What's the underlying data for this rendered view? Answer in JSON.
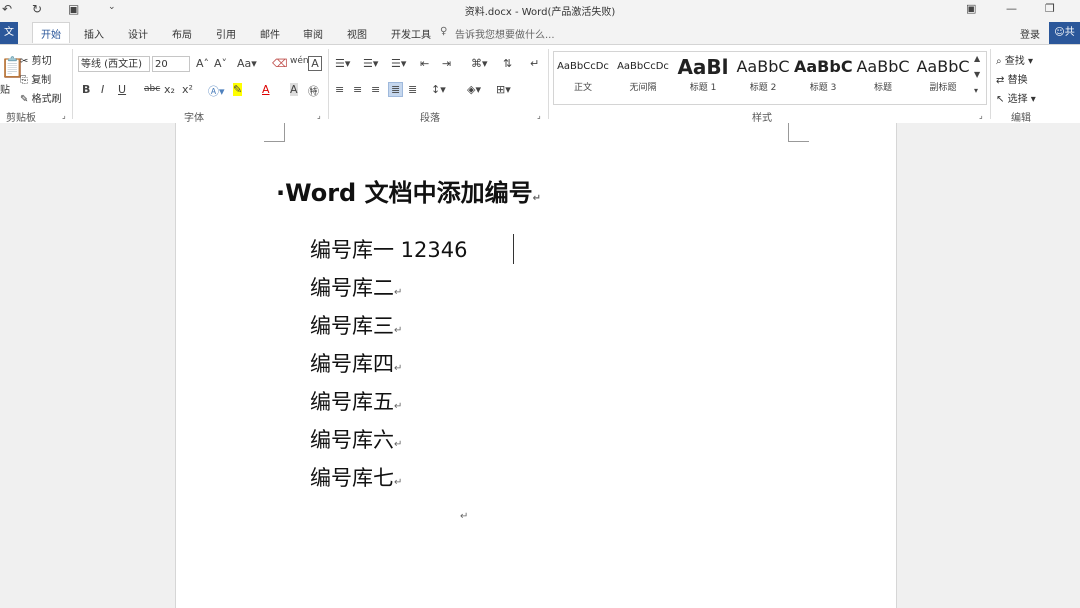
{
  "titlebar": {
    "title": "资料.docx - Word(产品激活失败)",
    "qa_icons": [
      "undo-icon",
      "redo-icon",
      "save-icon",
      "customize-icon"
    ],
    "window_icons": [
      "ribbon-display-icon",
      "minimize-icon",
      "restore-icon"
    ]
  },
  "tabs": {
    "file": "文件",
    "items": [
      "开始",
      "插入",
      "设计",
      "布局",
      "引用",
      "邮件",
      "审阅",
      "视图",
      "开发工具"
    ],
    "active": "开始",
    "tell_me": "告诉我您想要做什么...",
    "login": "登录",
    "share": "共"
  },
  "clipboard": {
    "paste": "贴",
    "cut": "剪切",
    "copy": "复制",
    "format_painter": "格式刷",
    "label": "剪贴板"
  },
  "font": {
    "name": "等线 (西文正)",
    "size": "20",
    "label": "字体",
    "buttons": [
      "B",
      "I",
      "U",
      "abc",
      "x₂",
      "x²"
    ]
  },
  "paragraph": {
    "label": "段落"
  },
  "styles": {
    "label": "样式",
    "items": [
      {
        "preview": "AaBbCcDc",
        "name": "正文"
      },
      {
        "preview": "AaBbCcDc",
        "name": "无间隔"
      },
      {
        "preview": "AaBl",
        "name": "标题 1"
      },
      {
        "preview": "AaBbC",
        "name": "标题 2"
      },
      {
        "preview": "AaBbC",
        "name": "标题 3"
      },
      {
        "preview": "AaBbC",
        "name": "标题"
      },
      {
        "preview": "AaBbC",
        "name": "副标题"
      }
    ]
  },
  "editing": {
    "find": "查找",
    "replace": "替换",
    "select": "选择",
    "label": "编辑"
  },
  "document": {
    "heading": "·Word 文档中添加编号",
    "items": [
      "编号库一 12346",
      "编号库二",
      "编号库三",
      "编号库四",
      "编号库五",
      "编号库六",
      "编号库七"
    ],
    "paragraph_mark": "↵"
  }
}
